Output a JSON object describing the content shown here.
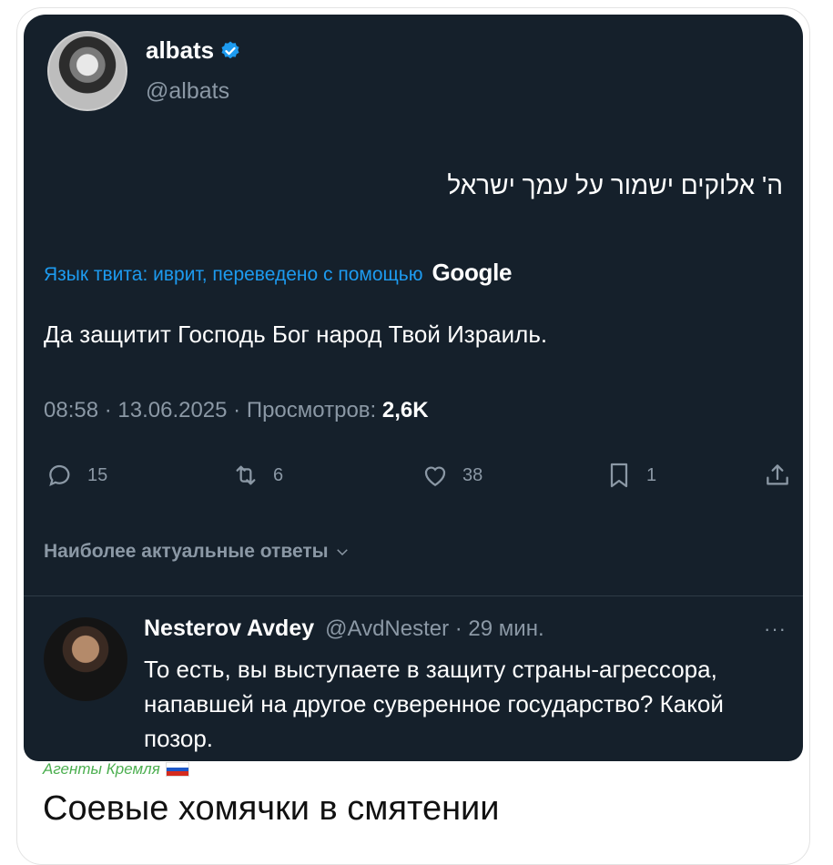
{
  "tweet": {
    "author_name": "albats",
    "author_handle": "@albats",
    "text_hebrew": "ה' אלוקים ישמור על עמך ישראל",
    "translate_note": "Язык твита: иврит, переведено с помощью",
    "translate_brand": "Google",
    "translation": "Да защитит Господь Бог народ Твой Израиль.",
    "timestamp": "08:58 · 13.06.2025 · Просмотров:",
    "views": "2,6K",
    "actions": {
      "replies": "15",
      "retweets": "6",
      "likes": "38",
      "bookmarks": "1"
    },
    "replies_filter": "Наиболее актуальные ответы"
  },
  "reply": {
    "name": "Nesterov Avdey",
    "handle_time": "@AvdNester · 29 мин.",
    "more": "···",
    "text": "То есть, вы выступаете в защиту страны-агрессора, напавшей на другое суверенное государство? Какой позор."
  },
  "post": {
    "channel": "Агенты Кремля",
    "caption": "Соевые хомячки в смятении"
  },
  "colors": {
    "tweet_bg": "#15202b",
    "link_blue": "#1d9bf0",
    "muted": "#8b98a5",
    "channel_green": "#4caf50"
  },
  "icons": [
    "verified-icon",
    "reply-icon",
    "retweet-icon",
    "like-icon",
    "bookmark-icon",
    "share-icon",
    "chevron-down-icon",
    "flag-ru-icon"
  ]
}
